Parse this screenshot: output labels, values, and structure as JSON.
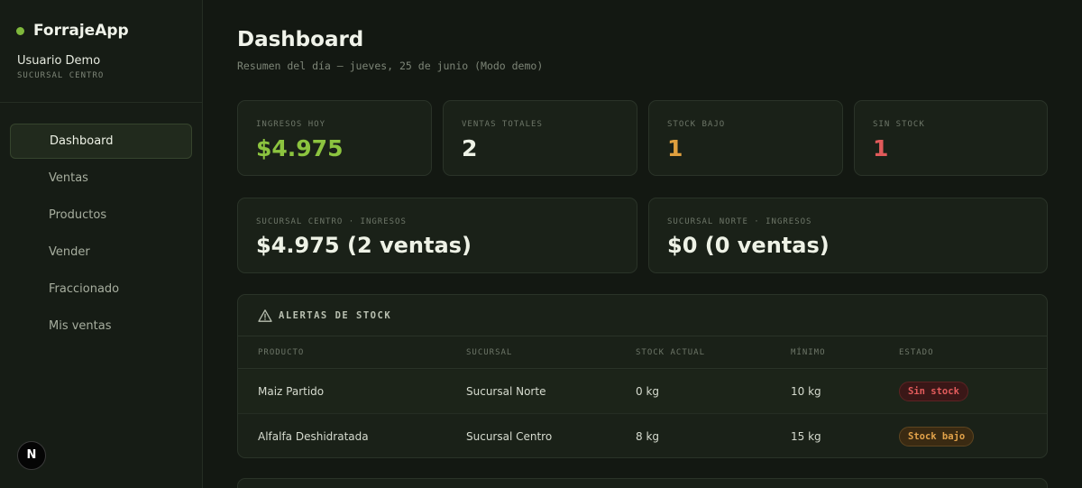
{
  "app": {
    "name": "ForrajeApp"
  },
  "user": {
    "name": "Usuario Demo",
    "branch": "SUCURSAL CENTRO"
  },
  "nav": {
    "items": [
      {
        "label": "Dashboard",
        "active": true
      },
      {
        "label": "Ventas"
      },
      {
        "label": "Productos"
      },
      {
        "label": "Vender"
      },
      {
        "label": "Fraccionado"
      },
      {
        "label": "Mis ventas"
      }
    ]
  },
  "header": {
    "title": "Dashboard",
    "subtitle": "Resumen del día — jueves, 25 de junio (Modo demo)"
  },
  "stats": [
    {
      "label": "INGRESOS HOY",
      "value": "$4.975",
      "color": "#8cc43f"
    },
    {
      "label": "VENTAS TOTALES",
      "value": "2",
      "color": "#eef2e6"
    },
    {
      "label": "STOCK BAJO",
      "value": "1",
      "color": "#e0a03e"
    },
    {
      "label": "SIN STOCK",
      "value": "1",
      "color": "#e05a5a"
    }
  ],
  "branches": [
    {
      "label": "SUCURSAL CENTRO · INGRESOS",
      "value": "$4.975 (2 ventas)"
    },
    {
      "label": "SUCURSAL NORTE · INGRESOS",
      "value": "$0 (0 ventas)"
    }
  ],
  "alerts": {
    "title": "ALERTAS DE STOCK",
    "columns": [
      "PRODUCTO",
      "SUCURSAL",
      "STOCK ACTUAL",
      "MÍNIMO",
      "ESTADO"
    ],
    "rows": [
      {
        "product": "Maiz Partido",
        "branch": "Sucursal Norte",
        "stock": "0 kg",
        "minimum": "10 kg",
        "status": "Sin stock"
      },
      {
        "product": "Alfalfa Deshidratada",
        "branch": "Sucursal Centro",
        "stock": "8 kg",
        "minimum": "15 kg",
        "status": "Stock bajo"
      }
    ]
  },
  "misc": {
    "badge_letter": "N"
  }
}
